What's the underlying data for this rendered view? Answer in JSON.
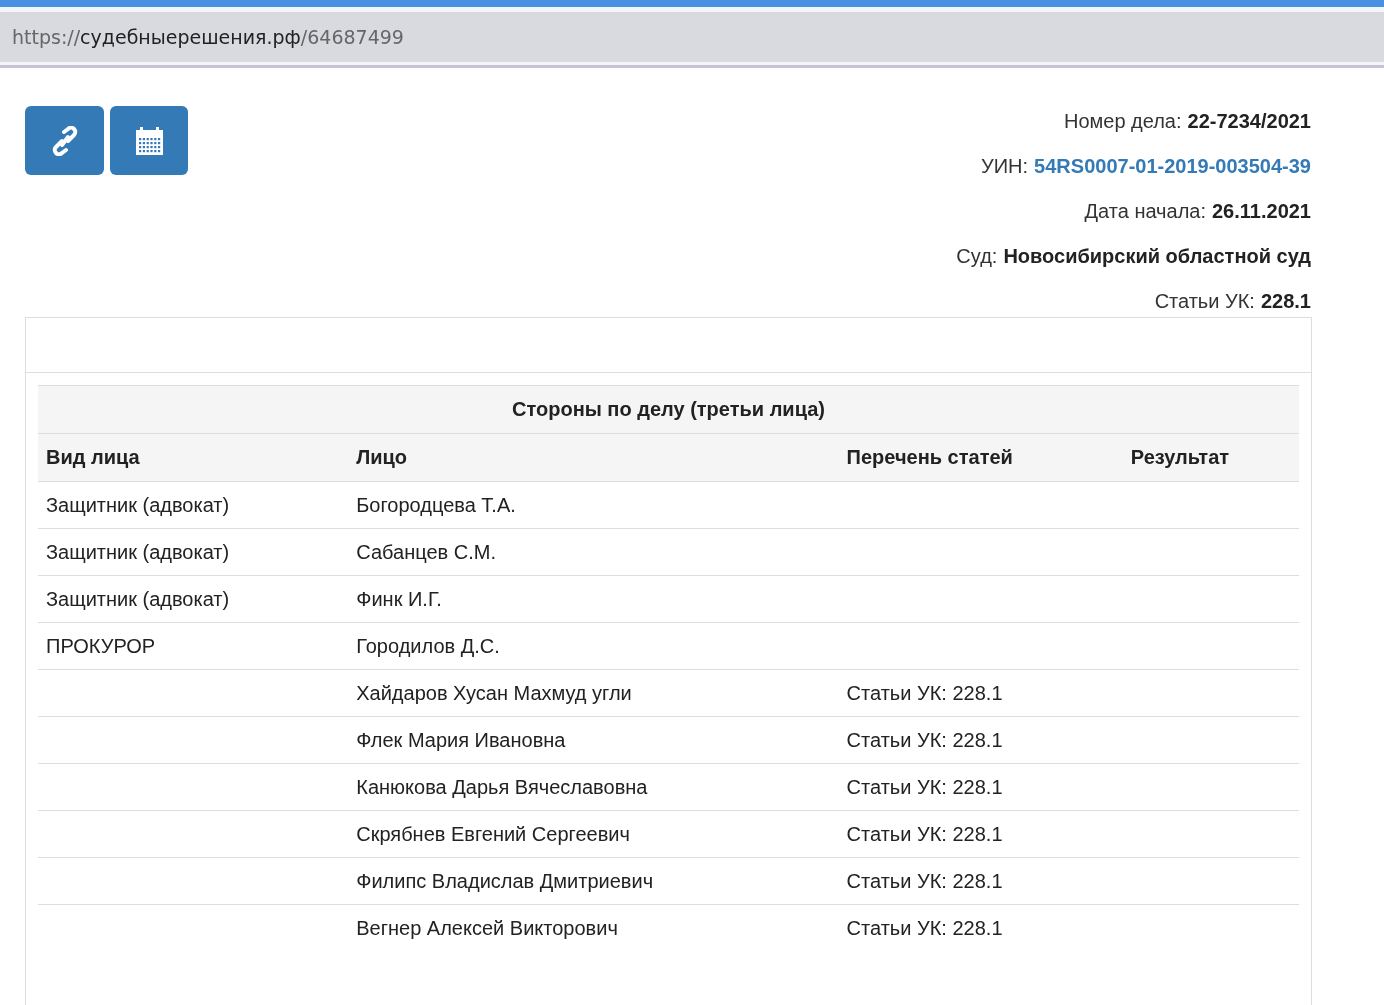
{
  "address_bar": {
    "scheme": "https://",
    "host": "судебныерешения.рф",
    "path": "/64687499"
  },
  "toolbar": {
    "buttons": [
      {
        "kind": "link"
      },
      {
        "kind": "calendar"
      }
    ]
  },
  "case_info": [
    {
      "label": "Номер дела:",
      "value": "22-7234/2021",
      "kind": "text"
    },
    {
      "label": "УИН:",
      "value": "54RS0007-01-2019-003504-39",
      "kind": "link"
    },
    {
      "label": "Дата начала:",
      "value": "26.11.2021",
      "kind": "text"
    },
    {
      "label": "Суд:",
      "value": "Новосибирский областной суд",
      "kind": "text"
    },
    {
      "label": "Статьи УК:",
      "value": "228.1",
      "kind": "text"
    }
  ],
  "table": {
    "title": "Стороны по делу (третьи лица)",
    "columns": [
      "Вид лица",
      "Лицо",
      "Перечень статей",
      "Результат"
    ],
    "rows": [
      {
        "role": "Защитник (адвокат)",
        "person": "Богородцева Т.А."
      },
      {
        "role": "Защитник (адвокат)",
        "person": "Сабанцев С.М."
      },
      {
        "role": "Защитник (адвокат)",
        "person": "Финк И.Г."
      },
      {
        "role": "ПРОКУРОР",
        "person": "Городилов Д.С."
      },
      {
        "person": "Хайдаров Хусан Махмуд угли",
        "articles": "Статьи УК: 228.1"
      },
      {
        "person": "Флек Мария Ивановна",
        "articles": "Статьи УК: 228.1"
      },
      {
        "person": "Канюкова Дарья Вячеславовна",
        "articles": "Статьи УК: 228.1"
      },
      {
        "person": "Скрябнев Евгений Сергеевич",
        "articles": "Статьи УК: 228.1"
      },
      {
        "person": "Филипс Владислав Дмитриевич",
        "articles": "Статьи УК: 228.1"
      },
      {
        "person": "Вегнер Алексей Викторович",
        "articles": "Статьи УК: 228.1"
      }
    ]
  }
}
